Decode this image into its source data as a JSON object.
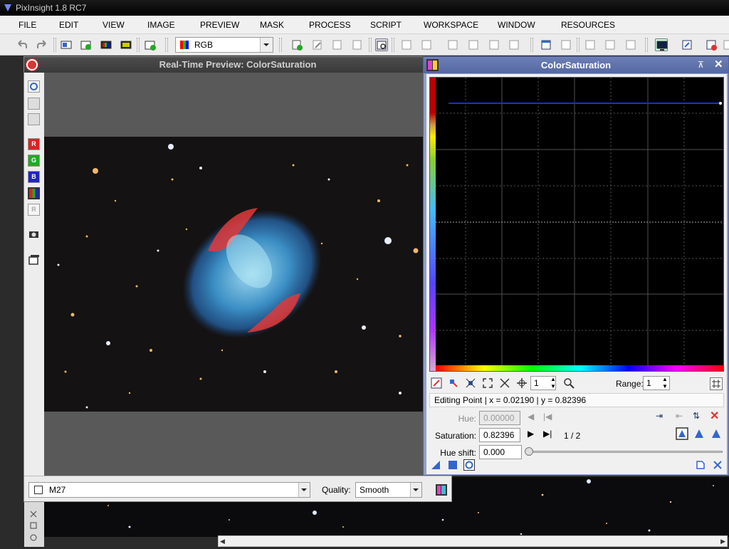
{
  "app": {
    "title": "PixInsight 1.8 RC7"
  },
  "menu": [
    "FILE",
    "EDIT",
    "VIEW",
    "IMAGE",
    "PREVIEW",
    "MASK",
    "PROCESS",
    "SCRIPT",
    "WORKSPACE",
    "WINDOW",
    "RESOURCES"
  ],
  "toolbar": {
    "channel_select": "RGB"
  },
  "preview": {
    "title": "Real-Time Preview: ColorSaturation",
    "channel_buttons": [
      "R",
      "G",
      "B",
      "R"
    ],
    "view_select": "M27",
    "quality_label": "Quality:",
    "quality_value": "Smooth"
  },
  "colorsat": {
    "title": "ColorSaturation",
    "zoom": "1",
    "range_label": "Range:",
    "range_value": "1",
    "editing_point": "Editing Point | x = 0.02190 | y = 0.82396",
    "hue_label": "Hue:",
    "hue_value": "0.00000",
    "saturation_label": "Saturation:",
    "saturation_value": "0.82396",
    "point_counter": "1 / 2",
    "hue_shift_label": "Hue shift:",
    "hue_shift_value": "0.000"
  },
  "colors": {
    "window_title_bar": "#5567a3",
    "close_red": "#d33333",
    "curve_line": "#1a2fd6"
  }
}
